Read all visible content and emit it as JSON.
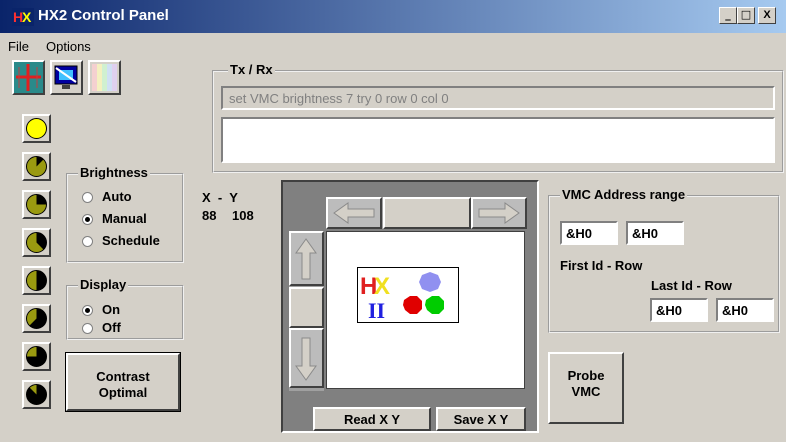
{
  "window": {
    "title": "HX2 Control Panel",
    "controls": {
      "minimize": "_",
      "maximize": "□",
      "close": "X"
    }
  },
  "menu": [
    "File",
    "Options"
  ],
  "toolbar": {
    "icons": [
      "crosshair-grid-icon",
      "monitor-icon",
      "color-bars-icon"
    ]
  },
  "txrx": {
    "legend": "Tx / Rx",
    "sent": "set VMC brightness 7 try 0 row 0 col 0",
    "received": ""
  },
  "brightness": {
    "legend": "Brightness",
    "options": [
      {
        "label": "Auto",
        "selected": false
      },
      {
        "label": "Manual",
        "selected": true
      },
      {
        "label": "Schedule",
        "selected": false
      }
    ],
    "levels": [
      0,
      1,
      2,
      3,
      4,
      5,
      6,
      7
    ]
  },
  "display": {
    "legend": "Display",
    "options": [
      {
        "label": "On",
        "selected": true
      },
      {
        "label": "Off",
        "selected": false
      }
    ]
  },
  "contrast": {
    "line1": "Contrast",
    "line2": "Optimal"
  },
  "xy": {
    "header": "X  -  Y",
    "x": "88",
    "y": "108"
  },
  "position": {
    "read_label": "Read X Y",
    "save_label": "Save X Y"
  },
  "vmc": {
    "legend": "VMC Address range",
    "first_row_id": "&H0",
    "first_col": "&H0",
    "first_label": "First Id - Row",
    "last_label": "Last Id - Row",
    "last_row_id": "&H0",
    "last_col": "&H0"
  },
  "probe": {
    "line1": "Probe",
    "line2": "VMC"
  },
  "colors": {
    "title_start": "#0a246a",
    "title_end": "#a6caf0",
    "face": "#d4d0c8",
    "bright_on": "#ffff00",
    "bright_dim": "#9a9a10"
  }
}
